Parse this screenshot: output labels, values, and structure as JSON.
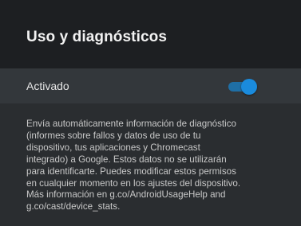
{
  "header": {
    "title": "Uso y diagnósticos"
  },
  "setting": {
    "label": "Activado",
    "state": "on",
    "accent_color": "#1a8bdd"
  },
  "description": {
    "text": "Envía automáticamente información de diagnóstico\n(informes sobre fallos y datos de uso de tu\ndispositivo, tus aplicaciones y Chromecast\nintegrado) a Google. Estos datos no se utilizarán\npara identificarte. Puedes modificar estos permisos\nen cualquier momento en los ajustes del dispositivo.\nMás información en g.co/AndroidUsageHelp and\ng.co/cast/device_stats."
  }
}
